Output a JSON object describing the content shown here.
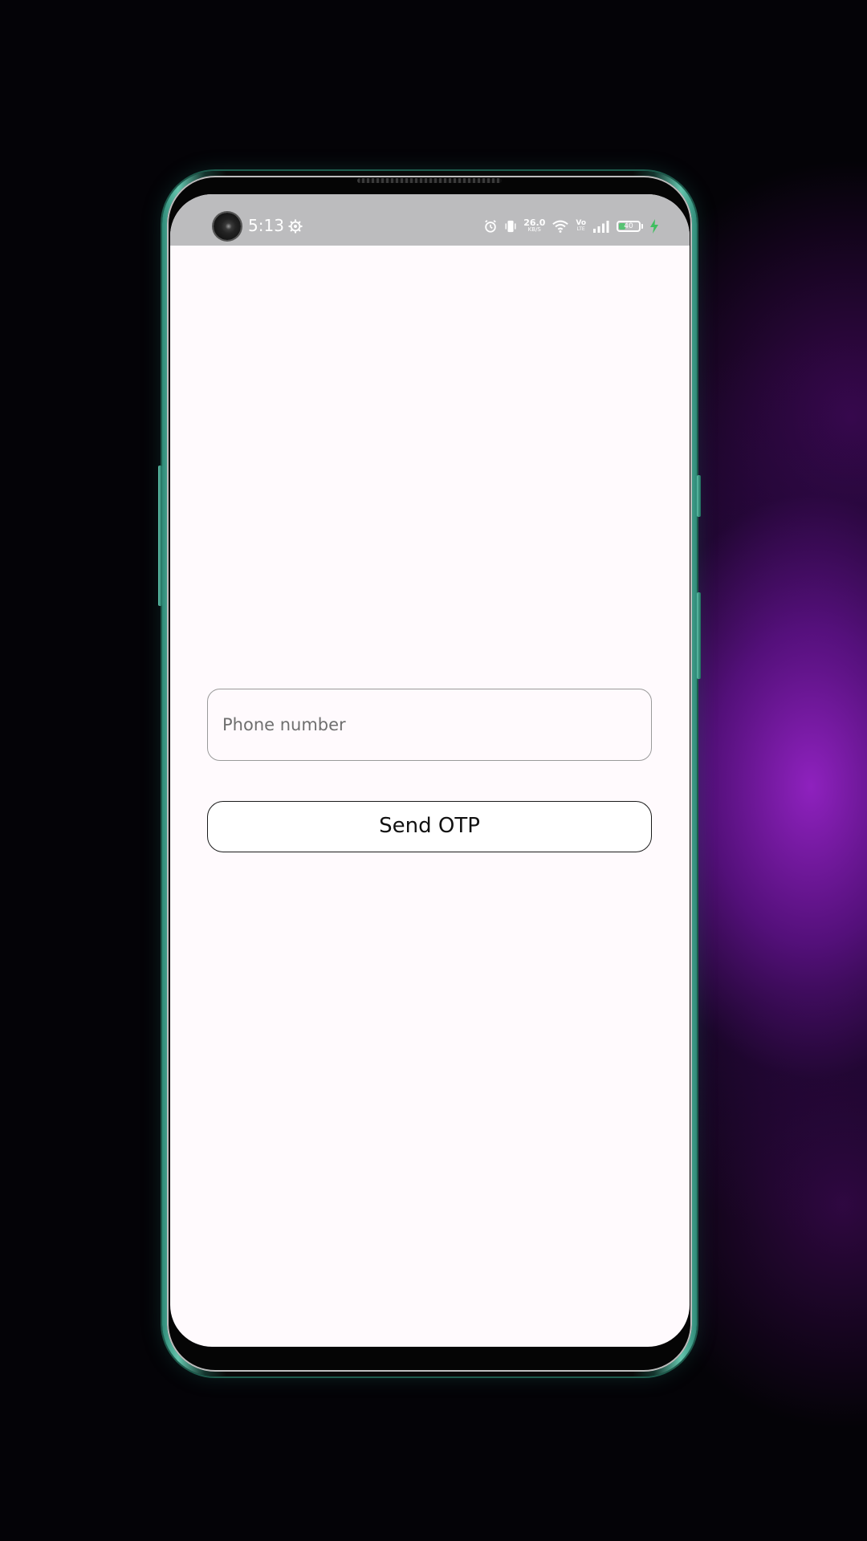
{
  "status_bar": {
    "time": "5:13",
    "network_speed_value": "26.0",
    "network_speed_unit": "KB/S",
    "volte_top": "Vo",
    "volte_bottom": "LTE",
    "battery_level": 40,
    "battery_label": "40",
    "charging": true,
    "icons": [
      "settings-icon",
      "alarm-icon",
      "vibrate-icon",
      "wifi-icon",
      "volte-icon",
      "signal-icon",
      "battery-icon",
      "charging-bolt-icon"
    ]
  },
  "login_form": {
    "phone_placeholder": "Phone number",
    "phone_value": "",
    "send_otp_label": "Send OTP"
  },
  "colors": {
    "status_bar_bg": "#bcbcbe",
    "screen_bg": "#fffafd",
    "battery_fill": "#58c273",
    "phone_frame_accent": "#64c5ad",
    "backdrop_glow": "#9623c8"
  }
}
